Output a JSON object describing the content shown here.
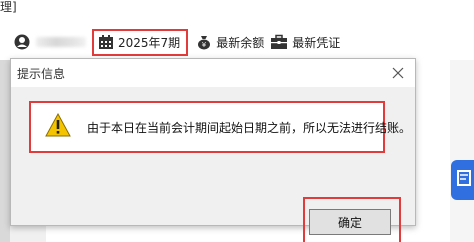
{
  "app": {
    "menu_fragment": "理]",
    "toolbar": {
      "period_label": "2025年7期",
      "latest_balance_label": "最新余额",
      "latest_voucher_label": "最新凭证"
    }
  },
  "dialog": {
    "title": "提示信息",
    "message": "由于本日在当前会计期间起始日期之前，所以无法进行结账。",
    "ok_label": "确定"
  },
  "colors": {
    "highlight_red": "#e23b3b",
    "accent_blue": "#2f6fe0",
    "warning_yellow": "#f5c400"
  },
  "icons": [
    "user-icon",
    "calendar-icon",
    "money-bag-icon",
    "briefcase-icon",
    "close-icon",
    "warning-icon"
  ]
}
